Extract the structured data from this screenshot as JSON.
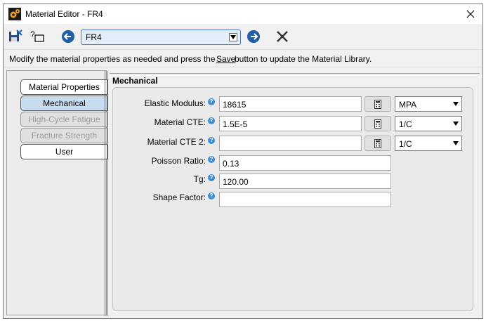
{
  "window": {
    "title": "Material Editor - FR4"
  },
  "toolbar": {
    "material_selected": "FR4"
  },
  "instructions": {
    "before": "Modify the material properties as needed and press the ",
    "link": "Save",
    "after": " button to update the Material Library."
  },
  "tabs": [
    {
      "label": "Material Properties",
      "state": "normal"
    },
    {
      "label": "Mechanical",
      "state": "active"
    },
    {
      "label": "High-Cycle Fatigue",
      "state": "disabled"
    },
    {
      "label": "Fracture Strength",
      "state": "disabled"
    },
    {
      "label": "User",
      "state": "normal"
    }
  ],
  "section": {
    "title": "Mechanical"
  },
  "fields": [
    {
      "label": "Elastic Modulus:",
      "value": "18615",
      "unit": "MPA"
    },
    {
      "label": "Material CTE:",
      "value": "1.5E-5",
      "unit": "1/C"
    },
    {
      "label": "Material CTE 2:",
      "value": "",
      "unit": "1/C"
    },
    {
      "label": "Poisson Ratio:",
      "value": "0.13"
    },
    {
      "label": "Tg:",
      "value": "120.00"
    },
    {
      "label": "Shape Factor:",
      "value": ""
    }
  ],
  "help_glyph": "?",
  "colors": {
    "accent": "#3b8fd9",
    "active_tab": "#c9dcef",
    "nav_arrow": "#1f5fa8"
  }
}
